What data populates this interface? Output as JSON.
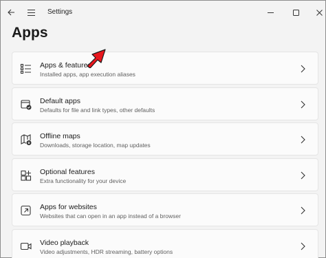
{
  "window": {
    "title": "Settings",
    "back_icon": "back-arrow-icon",
    "menu_icon": "hamburger-menu-icon",
    "min_icon": "minimize-icon",
    "max_icon": "maximize-icon",
    "close_icon": "close-icon"
  },
  "page": {
    "title": "Apps"
  },
  "items": [
    {
      "title": "Apps & features",
      "subtitle": "Installed apps, app execution aliases",
      "icon": "apps-list-icon"
    },
    {
      "title": "Default apps",
      "subtitle": "Defaults for file and link types, other defaults",
      "icon": "default-apps-icon"
    },
    {
      "title": "Offline maps",
      "subtitle": "Downloads, storage location, map updates",
      "icon": "offline-map-icon"
    },
    {
      "title": "Optional features",
      "subtitle": "Extra functionality for your device",
      "icon": "optional-features-icon"
    },
    {
      "title": "Apps for websites",
      "subtitle": "Websites that can open in an app instead of a browser",
      "icon": "apps-websites-icon"
    },
    {
      "title": "Video playback",
      "subtitle": "Video adjustments, HDR streaming, battery options",
      "icon": "video-playback-icon"
    }
  ],
  "colors": {
    "arrow": "#e8171e",
    "card_bg": "#fbfbfb",
    "window_bg": "#f3f3f3"
  }
}
